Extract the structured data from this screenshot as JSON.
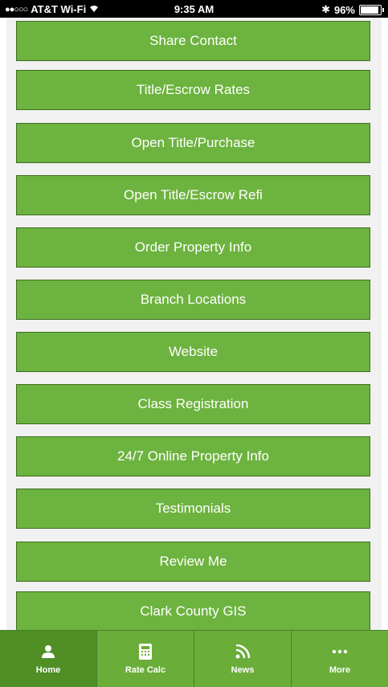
{
  "status_bar": {
    "signal_dots": "●●○○○",
    "carrier": "AT&T Wi-Fi",
    "time": "9:35 AM",
    "bluetooth": "✱",
    "battery": "96%"
  },
  "menu": {
    "items": [
      {
        "label": "Share Contact"
      },
      {
        "label": "Title/Escrow Rates"
      },
      {
        "label": "Open Title/Purchase"
      },
      {
        "label": "Open Title/Escrow Refi"
      },
      {
        "label": "Order Property Info"
      },
      {
        "label": "Branch Locations"
      },
      {
        "label": "Website"
      },
      {
        "label": "Class Registration"
      },
      {
        "label": "24/7 Online Property Info"
      },
      {
        "label": "Testimonials"
      },
      {
        "label": "Review Me"
      },
      {
        "label": "Clark County GIS"
      }
    ]
  },
  "tabs": [
    {
      "label": "Home",
      "icon": "person-icon",
      "active": true
    },
    {
      "label": "Rate Calc",
      "icon": "calculator-icon",
      "active": false
    },
    {
      "label": "News",
      "icon": "rss-icon",
      "active": false
    },
    {
      "label": "More",
      "icon": "more-icon",
      "active": false
    }
  ],
  "colors": {
    "button_green": "#6db33f",
    "tab_green": "#6aad39",
    "tab_active": "#4f8f24",
    "background": "#f1f1f1"
  }
}
